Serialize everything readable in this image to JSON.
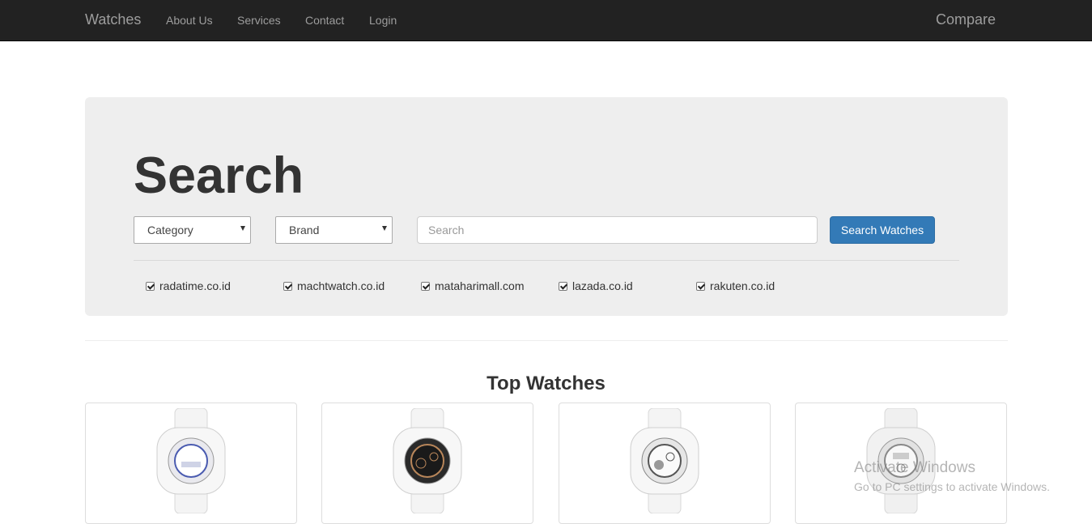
{
  "navbar": {
    "brand": "Watches",
    "links": [
      "About Us",
      "Services",
      "Contact",
      "Login"
    ],
    "right_link": "Compare"
  },
  "search": {
    "title": "Search",
    "category_select": "Category",
    "brand_select": "Brand",
    "input_placeholder": "Search",
    "button_label": "Search Watches",
    "stores": [
      {
        "label": "radatime.co.id",
        "checked": true
      },
      {
        "label": "machtwatch.co.id",
        "checked": true
      },
      {
        "label": "mataharimall.com",
        "checked": true
      },
      {
        "label": "lazada.co.id",
        "checked": true
      },
      {
        "label": "rakuten.co.id",
        "checked": true
      }
    ]
  },
  "top_watches": {
    "title": "Top Watches",
    "items": [
      {
        "name": "watch-image-1",
        "accent": "#4a5bb0"
      },
      {
        "name": "watch-image-2",
        "accent": "#b8865a"
      },
      {
        "name": "watch-image-3",
        "accent": "#555555"
      },
      {
        "name": "watch-image-4",
        "accent": "#888888"
      }
    ]
  },
  "os_watermark": {
    "title": "Activate Windows",
    "subtitle": "Go to PC settings to activate Windows."
  },
  "colors": {
    "navbar_bg": "#222222",
    "nav_text": "#9d9d9d",
    "primary_button": "#337ab7",
    "jumbotron_bg": "#eeeeee"
  }
}
